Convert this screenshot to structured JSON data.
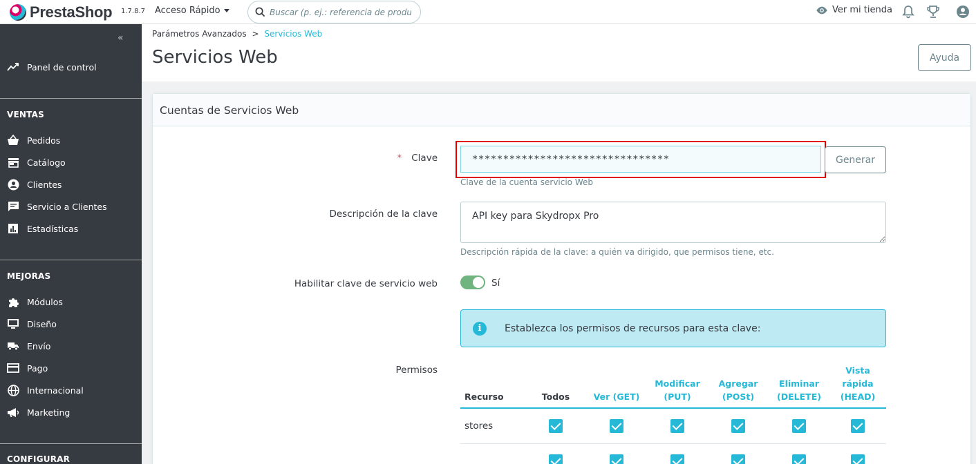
{
  "header": {
    "brand": "PrestaShop",
    "version": "1.7.8.7",
    "quick_access": "Acceso Rápido",
    "search_placeholder": "Buscar (p. ej.: referencia de producto, ",
    "view_store": "Ver mi tienda"
  },
  "sidebar": {
    "dashboard": "Panel de control",
    "sections": [
      {
        "title": "VENTAS",
        "items": [
          "Pedidos",
          "Catálogo",
          "Clientes",
          "Servicio a Clientes",
          "Estadísticas"
        ]
      },
      {
        "title": "MEJORAS",
        "items": [
          "Módulos",
          "Diseño",
          "Envío",
          "Pago",
          "Internacional",
          "Marketing"
        ]
      },
      {
        "title": "CONFIGURAR",
        "items": []
      }
    ]
  },
  "breadcrumb": {
    "parent": "Parámetros Avanzados",
    "separator": ">",
    "current": "Servicios Web"
  },
  "page": {
    "title": "Servicios Web",
    "help_button": "Ayuda"
  },
  "card": {
    "title": "Cuentas de Servicios Web"
  },
  "form": {
    "key_label": "Clave",
    "required_mark": "*",
    "key_value": "********************************",
    "generate_button": "Generar",
    "key_help": "Clave de la cuenta servicio Web",
    "desc_label": "Descripción de la clave",
    "desc_value": "API key para Skydropx Pro",
    "desc_help": "Descripción rápida de la clave: a quién va dirigido, que permisos tiene, etc.",
    "enable_label": "Habilitar clave de servicio web",
    "enable_state": "Sí",
    "enabled": true,
    "info_text": "Establezca los permisos de recursos para esta clave:",
    "permissions_label": "Permisos"
  },
  "permissions_table": {
    "headers": [
      "Recurso",
      "Todos",
      "Ver (GET)",
      "Modificar (PUT)",
      "Agregar (POSt)",
      "Eliminar (DELETE)",
      "Vista rápida (HEAD)"
    ],
    "rows": [
      {
        "resource": "stores",
        "checked": [
          true,
          true,
          true,
          true,
          true,
          true
        ]
      },
      {
        "resource": "",
        "checked": [
          true,
          true,
          true,
          true,
          true,
          true
        ]
      }
    ]
  },
  "colors": {
    "accent": "#25b9d7",
    "sidebar": "#363a41",
    "toggle_on": "#70b580",
    "highlight": "#e00000",
    "required": "#c05c67"
  }
}
